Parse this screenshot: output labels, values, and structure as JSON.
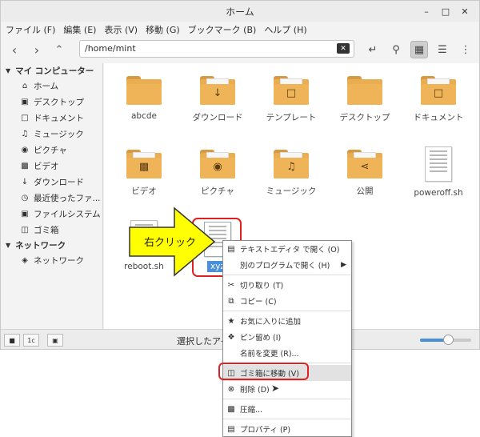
{
  "window": {
    "title": "ホーム"
  },
  "menubar": [
    "ファイル (F)",
    "編集 (E)",
    "表示 (V)",
    "移動 (G)",
    "ブックマーク (B)",
    "ヘルプ (H)"
  ],
  "toolbar": {
    "path": "/home/mint"
  },
  "sidebar": {
    "my_computer": "マイ コンピューター",
    "items": [
      "ホーム",
      "デスクトップ",
      "ドキュメント",
      "ミュージック",
      "ピクチャ",
      "ビデオ",
      "ダウンロード",
      "最近使ったファ...",
      "ファイルシステム",
      "ゴミ箱"
    ],
    "network_header": "ネットワーク",
    "network_items": [
      "ネットワーク"
    ]
  },
  "files": [
    "abcde",
    "ダウンロード",
    "テンプレート",
    "デスクトップ",
    "ドキュメント",
    "ビデオ",
    "ピクチャ",
    "ミュージック",
    "公開",
    "poweroff.sh",
    "reboot.sh",
    "xyz"
  ],
  "status": {
    "text": "選択したアイ",
    "zoom_level": 0.55
  },
  "callout": {
    "text": "右クリック"
  },
  "context_menu": [
    "テキストエディタ で開く (O)",
    "別のプログラムで開く (H)",
    "切り取り (T)",
    "コピー (C)",
    "お気に入りに追加",
    "ピン留め (I)",
    "名前を変更 (R)...",
    "ゴミ箱に移動 (V)",
    "削除 (D)",
    "圧縮...",
    "プロパティ (P)"
  ],
  "colors": {
    "folder": "#e9ae52",
    "highlight": "#e02020",
    "callout": "#ffff00",
    "selection": "#4a90d9"
  }
}
